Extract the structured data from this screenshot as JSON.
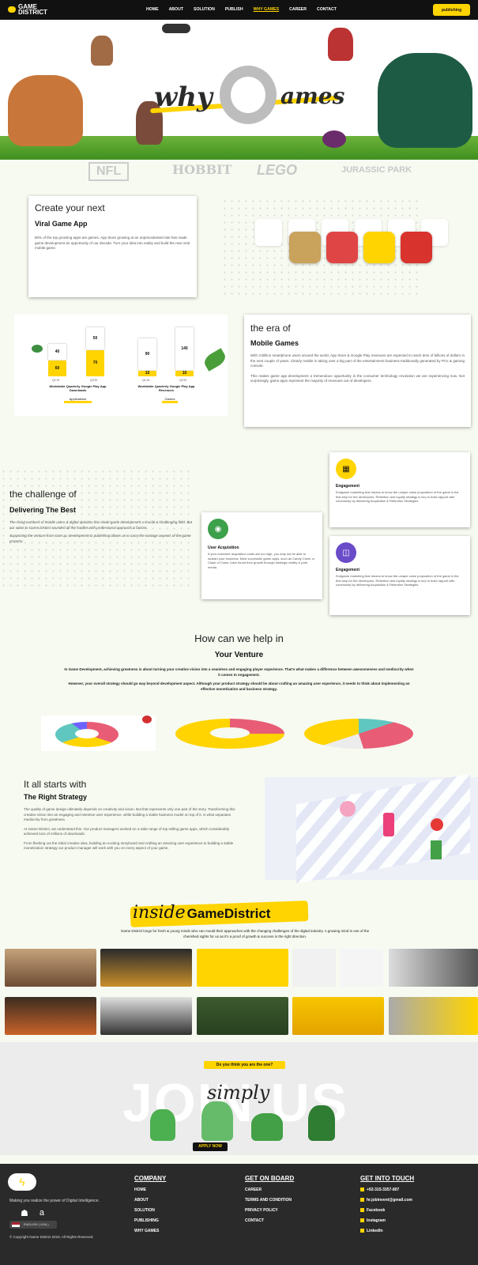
{
  "nav": {
    "logo_line1": "GAME",
    "logo_line2": "DISTRICT",
    "links": [
      "HOME",
      "ABOUT",
      "SOLUTION",
      "PUBLISH",
      "WHY GAMES",
      "CAREER",
      "CONTACT"
    ],
    "active": "WHY GAMES",
    "cta": "publishing"
  },
  "hero": {
    "why": "why",
    "g": "G",
    "ames": "ames",
    "brands": [
      "NFL",
      "HOBBIT",
      "LEGO",
      "JURASSIC PARK"
    ]
  },
  "viral": {
    "heading_light": "Create your next",
    "heading_bold": "Viral Game App",
    "body": "80% of the top grossing apps are games. App Store growing at an unprecedented rate has made game development an opportunity of our decade. Turn your idea into reality and build the next viral mobile game."
  },
  "era": {
    "heading_light": "the era of",
    "heading_bold": "Mobile Games",
    "para1": "With 3 Billion smartphone users around the world, App Store & Google Play revenues are expected to reach tens of billions of dollars in the next couple of years. Clearly mobile is taking over a big part of the entertainment business traditionally generated by PCs & gaming console.",
    "para2": "This makes game app development a tremendous opportunity in the consumer technology revolution we are experiencing now. Not surprisingly, game apps represent the majority of revenues out of developers.",
    "chart1": {
      "title": "Worldwide Quarterly Google Play App Downloads",
      "bars": [
        "40",
        "60",
        "50",
        "70"
      ],
      "labels": [
        "Q1'19",
        "Q2'20"
      ],
      "tag": "Applications"
    },
    "chart2": {
      "title": "Worldwide Quarterly Google Play App Revenues",
      "bars": [
        "90",
        "10",
        "140",
        "10"
      ],
      "labels": [
        "Q1'19",
        "Q2'20"
      ],
      "tag": "Games"
    }
  },
  "challenge": {
    "heading_light": "the challenge of",
    "heading_bold": "Delivering The Best",
    "para1": "The rising numbers of mobile users & digital opinions has made game development a crucial & challenging field. But our value to Game District sounded all the hurdles with professional approach & factors.",
    "para2": "Supporting the venture from start-up, development to publishing allows us to carry the vantage aspects of the game property.",
    "cards": [
      {
        "title": "Engagement",
        "body": "Endgame marketing that means to know the unique value proposition of the game is the first step for the developers. Retention and loyalty strategy is key to build rapport with community by delivering Acquisition & Retention Strategies."
      },
      {
        "title": "User Acquisition",
        "body": "If your customer acquisition costs are too high, you may not be able to sustain your business. Most successful game apps, such as Candy Crush or Clash of Clans, have found their growth through strategic virality & paid media."
      },
      {
        "title": "Engagement",
        "body": "Endgame marketing that means to know the unique value proposition of the game is the first step for the developers. Retention and loyalty strategy is key to build rapport with community by delivering Acquisition & Retention Strategies."
      }
    ]
  },
  "venture": {
    "heading_light": "How can we help in",
    "heading_bold": "Your Venture",
    "para1": "In Game Development, achieving greatness is about turning your creative vision into a seamless and engaging player experience. That's what makes a difference between awesomeness and mediocrity when it comes to engagement.",
    "para2": "However, your overall strategy should go way beyond development aspect. Although your product strategy should be about crafting an amazing user experience, it needs to think about implementing an effective monetization and business strategy."
  },
  "strategy": {
    "heading_light": "It all starts with",
    "heading_bold": "The Right Strategy",
    "para1": "The quality of game design ultimately depends on creativity and vision. But that represents only one part of the story. Transforming this creative vision into an engaging and retentive user experience, while building a viable business model on top of it, is what separates mediocrity from greatness.",
    "para2": "At Game District, we understand this. Our product managers worked on a wide range of top selling game apps, which considerably achieved tons of millions of downloads.",
    "para3": "From fleshing out the initial creative idea, building an exciting storyboard and crafting an amazing user experience to building a stable monetization strategy our product manager will work with you on every aspect of your game."
  },
  "inside": {
    "script": "inside",
    "bold": "GameDistrict",
    "body": "Game District longs for fresh & young minds who can mould their approaches with the changing challenges of the digital industry. A growing mind is one of the cherished sights for us as it's a proof of growth & success in the right direction."
  },
  "join": {
    "question": "Do you think you are the one?",
    "script": "simply",
    "big": "JOIN US",
    "button": "APPLY NOW"
  },
  "footer": {
    "tagline": "Making you realize the power of Digital Intelligence.",
    "language": "ENGLISH ( USA )",
    "copyright": "© Copyright Game District 2019, All Rights Reserved.",
    "company_head": "COMPANY",
    "company": [
      "HOME",
      "ABOUT",
      "SOLUTION",
      "PUBLISHING",
      "WHY GAMES"
    ],
    "board_head": "GET ON BOARD",
    "board": [
      "CAREER",
      "TERMS AND CONDITION",
      "PRIVACY POLICY",
      "CONTACT"
    ],
    "touch_head": "GET INTO TOUCH",
    "touch": [
      "+92-315-3357-807",
      "hr.jobinvent@gmail.com",
      "Facebook",
      "Instagram",
      "LinkedIn"
    ]
  },
  "colors": {
    "accent": "#ffd400",
    "dark": "#111111",
    "footer": "#2a2a2a",
    "bg": "#f7faf1"
  }
}
